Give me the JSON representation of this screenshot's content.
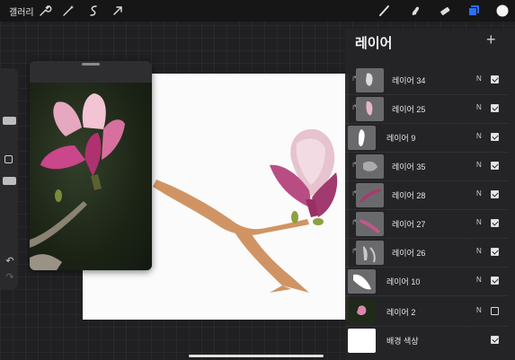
{
  "topbar": {
    "gallery_label": "갤러리",
    "left_icons": [
      "wrench-icon",
      "magic-wand-icon",
      "selection-icon",
      "transform-arrow-icon"
    ],
    "right_icons": [
      "brush-icon",
      "smudge-icon",
      "eraser-icon",
      "layers-icon",
      "color-swatch-icon"
    ],
    "accent_color": "#2f6cf6"
  },
  "layers_panel": {
    "title": "레이어",
    "add_label": "+",
    "layers": [
      {
        "name": "레이어 34",
        "blend": "N",
        "visible": true,
        "clipped": true
      },
      {
        "name": "레이어 25",
        "blend": "N",
        "visible": true,
        "clipped": true
      },
      {
        "name": "레이어 9",
        "blend": "N",
        "visible": true,
        "clipped": false
      },
      {
        "name": "레이어 35",
        "blend": "N",
        "visible": true,
        "clipped": true
      },
      {
        "name": "레이어 28",
        "blend": "N",
        "visible": true,
        "clipped": true
      },
      {
        "name": "레이어 27",
        "blend": "N",
        "visible": true,
        "clipped": true
      },
      {
        "name": "레이어 26",
        "blend": "N",
        "visible": true,
        "clipped": true
      },
      {
        "name": "레이어 10",
        "blend": "N",
        "visible": true,
        "clipped": false
      },
      {
        "name": "레이어 2",
        "blend": "N",
        "visible": false,
        "clipped": false
      },
      {
        "name": "배경 색상",
        "blend": "",
        "visible": true,
        "clipped": false
      }
    ]
  },
  "sidebar": {
    "undo_label": "↶",
    "redo_label": "↷"
  }
}
